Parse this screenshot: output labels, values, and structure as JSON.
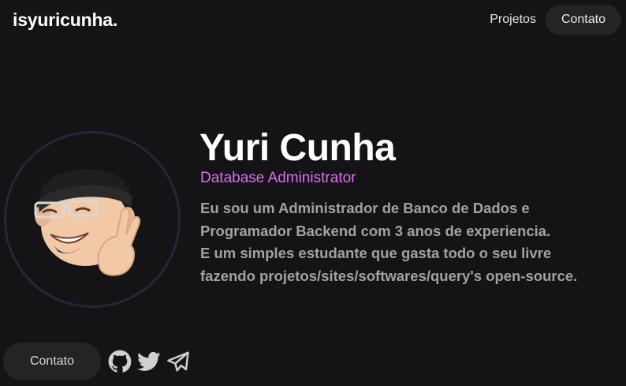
{
  "header": {
    "logo_text": "isyuricunha.",
    "nav": {
      "projects_label": "Projetos",
      "contact_label": "Contato"
    }
  },
  "profile": {
    "name": "Yuri Cunha",
    "role": "Database Administrator",
    "bio_lines": [
      "Eu sou um Administrador de Banco de Dados e",
      "Programador Backend com 3 anos de experiencia.",
      "E um simples estudante que gasta todo o seu livre",
      "fazendo projetos/sites/softwares/query's open-source."
    ],
    "avatar_icon": "memoji-avatar"
  },
  "footer": {
    "contact_label": "Contato",
    "socials": [
      {
        "icon": "github-icon"
      },
      {
        "icon": "twitter-icon"
      },
      {
        "icon": "telegram-icon"
      }
    ]
  },
  "colors": {
    "background": "#141416",
    "accent_role": "#df6ef0",
    "pill_bg": "#242427",
    "ring": "#22283a",
    "icon": "#d0d0d4"
  }
}
